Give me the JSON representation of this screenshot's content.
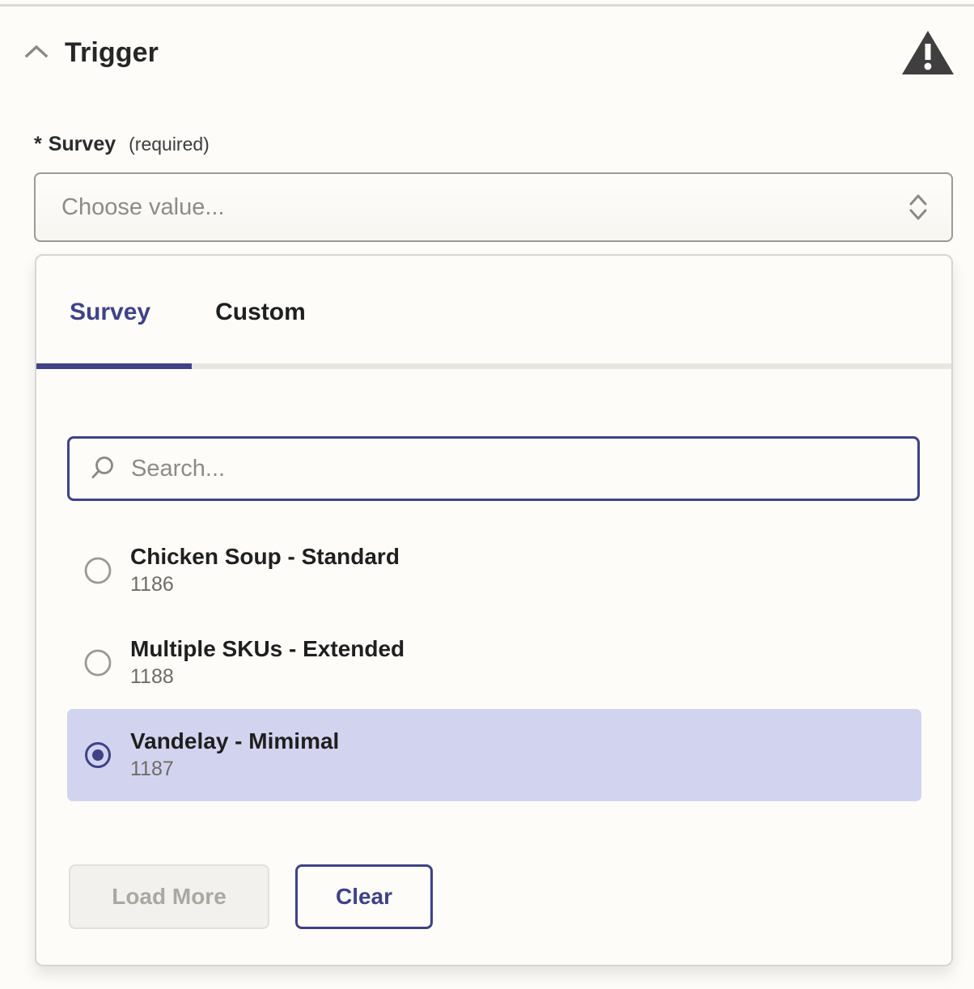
{
  "colors": {
    "accent": "#3f4287",
    "page_bg": "#fdfcf8",
    "selected_row_bg": "#d2d4ef",
    "muted_text": "#8c8b86",
    "warning": "#3f3f3f"
  },
  "section": {
    "title": "Trigger",
    "collapse_icon": "chevron-up-icon",
    "status_icon": "warning-triangle-icon"
  },
  "field": {
    "required_mark": "*",
    "label": "Survey",
    "hint": "(required)",
    "select": {
      "value": "",
      "placeholder": "Choose value...",
      "icon": "selector-up-down-icon"
    }
  },
  "dropdown": {
    "tabs": [
      {
        "label": "Survey",
        "active": true
      },
      {
        "label": "Custom",
        "active": false
      }
    ],
    "search": {
      "value": "",
      "placeholder": "Search...",
      "icon": "search-icon",
      "focused": true
    },
    "options": [
      {
        "title": "Chicken Soup - Standard",
        "subtitle": "1186",
        "selected": false
      },
      {
        "title": "Multiple SKUs - Extended",
        "subtitle": "1188",
        "selected": false
      },
      {
        "title": "Vandelay - Mimimal",
        "subtitle": "1187",
        "selected": true
      }
    ],
    "buttons": {
      "load_more": "Load More",
      "load_more_disabled": true,
      "clear": "Clear"
    }
  }
}
